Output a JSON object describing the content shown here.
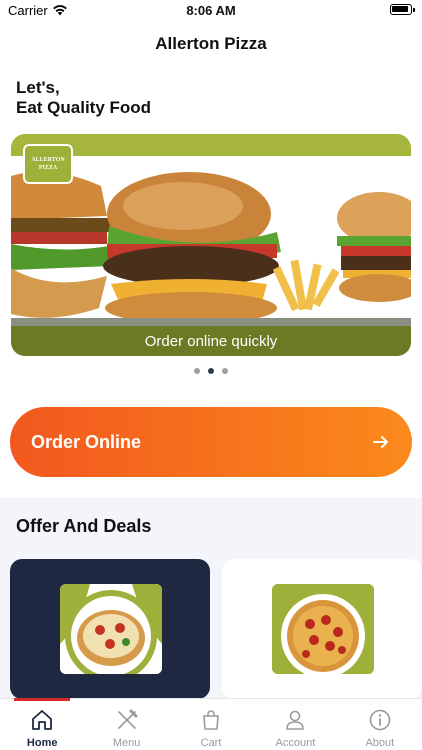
{
  "status": {
    "carrier": "Carrier",
    "time": "8:06 AM"
  },
  "header": {
    "title": "Allerton Pizza"
  },
  "greeting": {
    "line1": "Let's,",
    "line2": "Eat Quality Food"
  },
  "banner": {
    "logo_text": "ALLERTON PIZZA",
    "caption": "Order online quickly",
    "slide_count": 3,
    "active_slide": 2
  },
  "order_button": {
    "label": "Order Online"
  },
  "offers": {
    "title": "Offer And Deals"
  },
  "tabs": [
    {
      "label": "Home",
      "icon": "home-icon",
      "active": true
    },
    {
      "label": "Menu",
      "icon": "fork-knife-icon",
      "active": false
    },
    {
      "label": "Cart",
      "icon": "bag-icon",
      "active": false
    },
    {
      "label": "Account",
      "icon": "person-icon",
      "active": false
    },
    {
      "label": "About",
      "icon": "info-icon",
      "active": false
    }
  ],
  "colors": {
    "accent_start": "#f2581e",
    "accent_end": "#fb8a1c",
    "olive": "#a6b63c",
    "navy": "#1e2840",
    "tab_indicator": "#d72a2a"
  }
}
